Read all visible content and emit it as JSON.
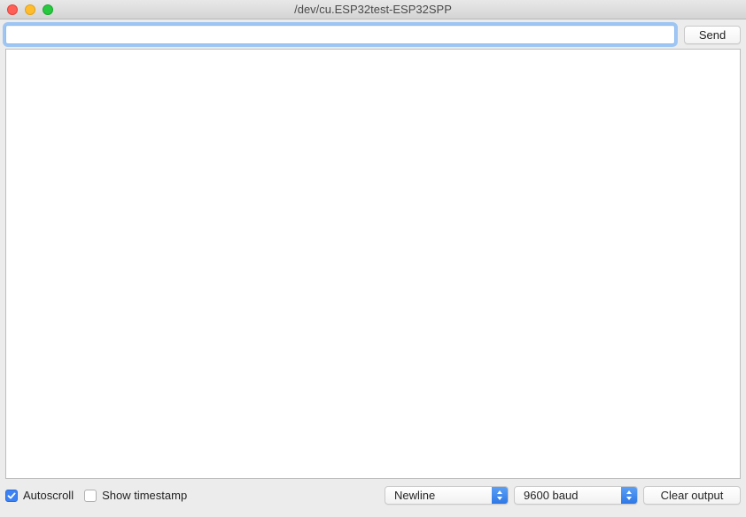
{
  "window": {
    "title": "/dev/cu.ESP32test-ESP32SPP"
  },
  "input": {
    "value": "",
    "send_label": "Send"
  },
  "output": {
    "content": ""
  },
  "footer": {
    "autoscroll": {
      "label": "Autoscroll",
      "checked": true
    },
    "timestamp": {
      "label": "Show timestamp",
      "checked": false
    },
    "line_ending": {
      "selected": "Newline"
    },
    "baud": {
      "selected": "9600 baud"
    },
    "clear_label": "Clear output"
  }
}
